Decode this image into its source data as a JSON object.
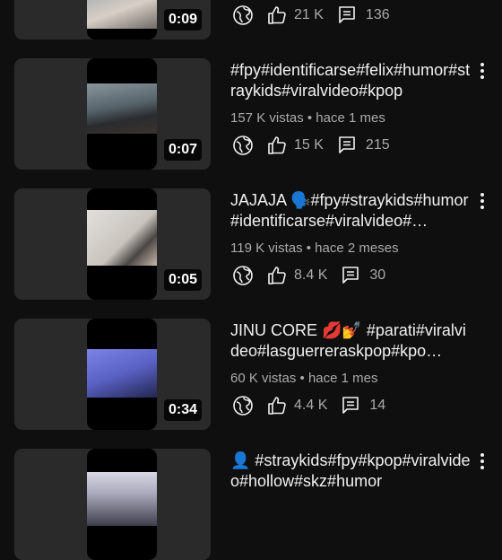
{
  "videos": [
    {
      "title": "",
      "meta": "",
      "duration": "0:09",
      "likes": "21 K",
      "comments": "136",
      "thumb_colors": [
        "#8b8f97",
        "#c9c2bb"
      ]
    },
    {
      "title": "#fpy#identificarse#felix#humor#straykids#viralvideo#kpop",
      "meta": "157 K vistas • hace 1 mes",
      "duration": "0:07",
      "likes": "15 K",
      "comments": "215",
      "thumb_colors": [
        "#5e6a72",
        "#1e1f22"
      ]
    },
    {
      "title": "JAJAJA 🗣️#fpy#straykids#humor#identificarse#viralvideo#…",
      "meta": "119 K vistas • hace 2 meses",
      "duration": "0:05",
      "likes": "8.4 K",
      "comments": "30",
      "thumb_colors": [
        "#d9d6d2",
        "#b9b4ad"
      ]
    },
    {
      "title": "JINU CORE 💋💅 #parati#viralvideo#lasguerreraskpop#kpo…",
      "meta": "60 K vistas • hace 1 mes",
      "duration": "0:34",
      "likes": "4.4 K",
      "comments": "14",
      "thumb_colors": [
        "#6a73d6",
        "#2a2f7a"
      ]
    },
    {
      "title": "👤 #straykids#fpy#kpop#viralvideo#hollow#skz#humor",
      "meta": "",
      "duration": "",
      "likes": "",
      "comments": "",
      "thumb_colors": [
        "#c8c8d8",
        "#3a3a48"
      ]
    }
  ],
  "icons": {
    "visibility": "globe-icon",
    "like": "thumbs-up-icon",
    "comment": "comment-icon",
    "menu": "more-vert-icon"
  },
  "colors": {
    "background": "#0f0f0f",
    "text": "#f1f1f1",
    "secondary_text": "#aaaaaa"
  }
}
